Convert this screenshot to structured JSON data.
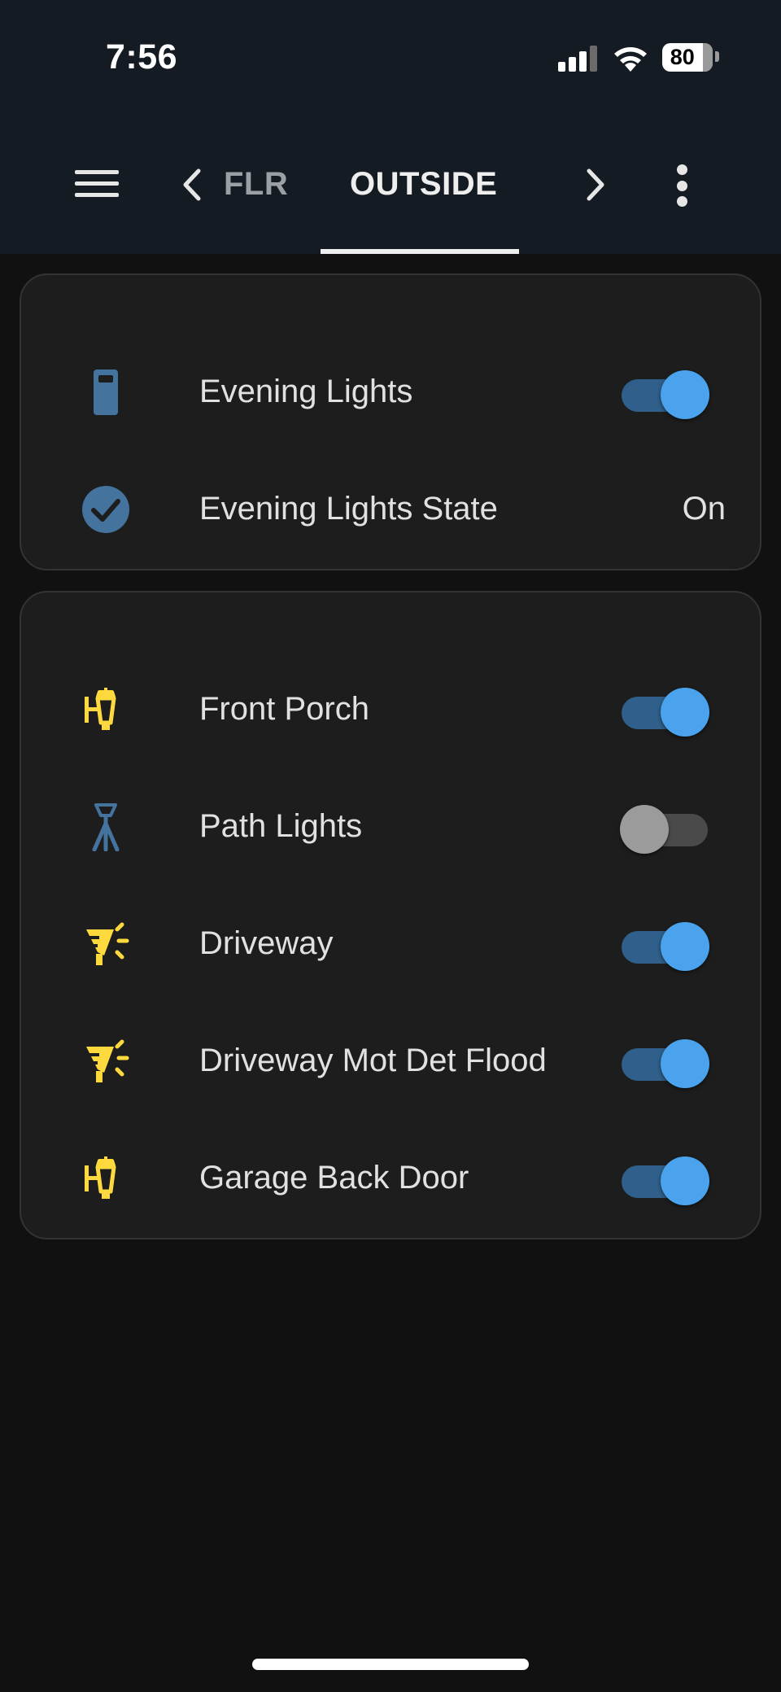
{
  "status_bar": {
    "time": "7:56",
    "battery": "80"
  },
  "header": {
    "tabs": [
      {
        "label": "FLR",
        "active": false
      },
      {
        "label": "OUTSIDE",
        "active": true
      }
    ]
  },
  "cards": [
    {
      "rows": [
        {
          "icon": "remote-icon",
          "label": "Evening Lights",
          "type": "toggle",
          "on": true
        },
        {
          "icon": "check-circle-icon",
          "label": "Evening Lights State",
          "type": "state",
          "state": "On"
        }
      ]
    },
    {
      "rows": [
        {
          "icon": "outdoor-lamp-icon",
          "label": "Front Porch",
          "type": "toggle",
          "on": true
        },
        {
          "icon": "path-lamp-icon",
          "label": "Path Lights",
          "type": "toggle",
          "on": false
        },
        {
          "icon": "floodlight-icon",
          "label": "Driveway",
          "type": "toggle",
          "on": true
        },
        {
          "icon": "floodlight-icon",
          "label": "Driveway Mot Det Flood",
          "type": "toggle",
          "on": true
        },
        {
          "icon": "outdoor-lamp-icon",
          "label": "Garage Back Door",
          "type": "toggle",
          "on": true
        }
      ]
    }
  ],
  "colors": {
    "header_bg": "#151b23",
    "page_bg": "#111111",
    "card_bg": "#1d1d1d",
    "toggle_on": "#4aa3ec",
    "icon_yellow": "#fdd93d",
    "icon_blue": "#44739e"
  }
}
